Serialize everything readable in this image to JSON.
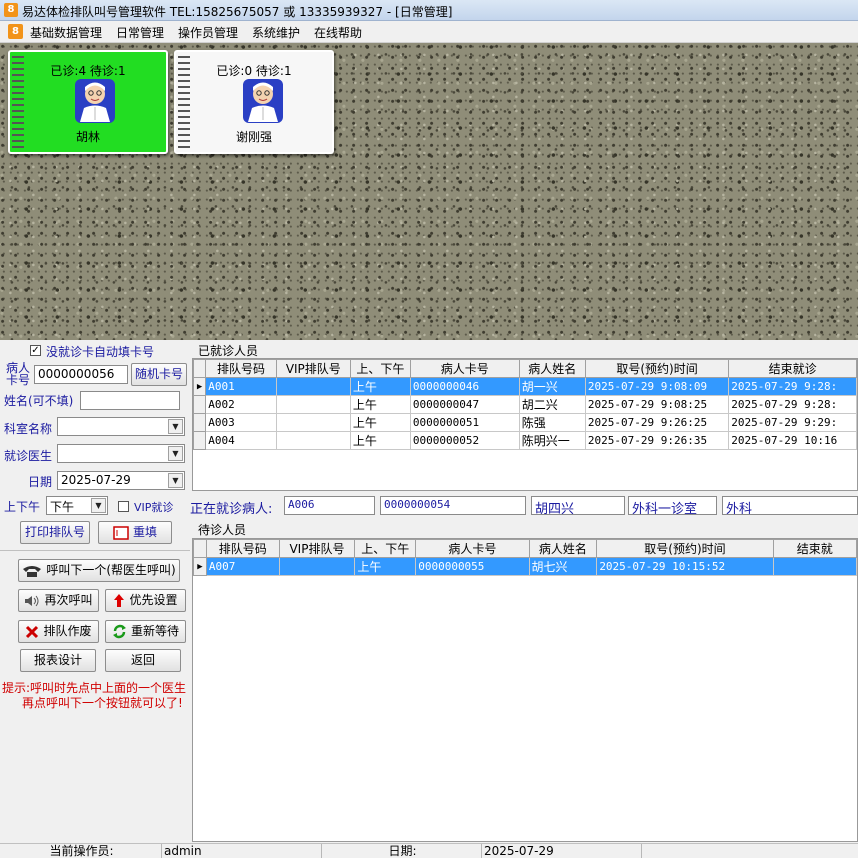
{
  "window": {
    "app_icon": "yida-app-icon",
    "title": "易达体检排队叫号管理软件    TEL:15825675057 或 13335939327  - [日常管理]"
  },
  "menu": {
    "icon": "yida-app-icon",
    "items": [
      "基础数据管理",
      "日常管理",
      "操作员管理",
      "系统维护",
      "在线帮助"
    ]
  },
  "doctors": [
    {
      "stats": "已诊:4  待诊:1",
      "name": "胡林",
      "active": true,
      "color": "#22dd22"
    },
    {
      "stats": "已诊:0  待诊:1",
      "name": "谢刚强",
      "active": false,
      "color": "#f7f7f7"
    }
  ],
  "form": {
    "auto_fill_label": "没就诊卡自动填卡号",
    "auto_fill_checked": true,
    "card_label": "病人卡号",
    "card_value": "0000000056",
    "random_card_button": "随机卡号",
    "name_label": "姓名(可不填)",
    "name_value": "",
    "dept_label": "科室名称",
    "dept_value": "",
    "doctor_label": "就诊医生",
    "doctor_value": "",
    "date_label": "日期",
    "date_value": "2025-07-29",
    "period_label": "上下午",
    "period_value": "下午",
    "vip_label": "VIP就诊",
    "vip_checked": false,
    "print_button": "打印排队号",
    "reset_button": "重填"
  },
  "actions": {
    "call_next": "呼叫下一个(帮医生呼叫)",
    "recall": "再次呼叫",
    "priority": "优先设置",
    "void": "排队作废",
    "requeue": "重新等待",
    "report": "报表设计",
    "back": "返回"
  },
  "tip": {
    "line1": "提示:呼叫时先点中上面的一个医生",
    "line2": "再点呼叫下一个按钮就可以了!"
  },
  "seen": {
    "title": "已就诊人员",
    "columns": [
      "排队号码",
      "VIP排队号",
      "上、下午",
      "病人卡号",
      "病人姓名",
      "取号(预约)时间",
      "结束就诊"
    ],
    "rows": [
      {
        "queue": "A001",
        "vip": "",
        "period": "上午",
        "card": "0000000046",
        "name": "胡一兴",
        "time": "2025-07-29 9:08:09",
        "end": "2025-07-29 9:28:",
        "selected": true
      },
      {
        "queue": "A002",
        "vip": "",
        "period": "上午",
        "card": "0000000047",
        "name": "胡二兴",
        "time": "2025-07-29 9:08:25",
        "end": "2025-07-29 9:28:",
        "selected": false
      },
      {
        "queue": "A003",
        "vip": "",
        "period": "上午",
        "card": "0000000051",
        "name": "陈强",
        "time": "2025-07-29 9:26:25",
        "end": "2025-07-29 9:29:",
        "selected": false
      },
      {
        "queue": "A004",
        "vip": "",
        "period": "上午",
        "card": "0000000052",
        "name": "陈明兴一",
        "time": "2025-07-29 9:26:35",
        "end": "2025-07-29 10:16",
        "selected": false
      }
    ]
  },
  "current": {
    "label": "正在就诊病人:",
    "queue": "A006",
    "card": "0000000054",
    "name": "胡四兴",
    "room": "外科一诊室",
    "dept": "外科"
  },
  "waiting": {
    "title": "待诊人员",
    "columns": [
      "排队号码",
      "VIP排队号",
      "上、下午",
      "病人卡号",
      "病人姓名",
      "取号(预约)时间",
      "结束就"
    ],
    "rows": [
      {
        "queue": "A007",
        "vip": "",
        "period": "上午",
        "card": "0000000055",
        "name": "胡七兴",
        "time": "2025-07-29 10:15:52",
        "end": "",
        "selected": true
      }
    ]
  },
  "status": {
    "operator_label": "当前操作员:",
    "operator": "admin",
    "date_label": "日期:",
    "date": "2025-07-29"
  }
}
